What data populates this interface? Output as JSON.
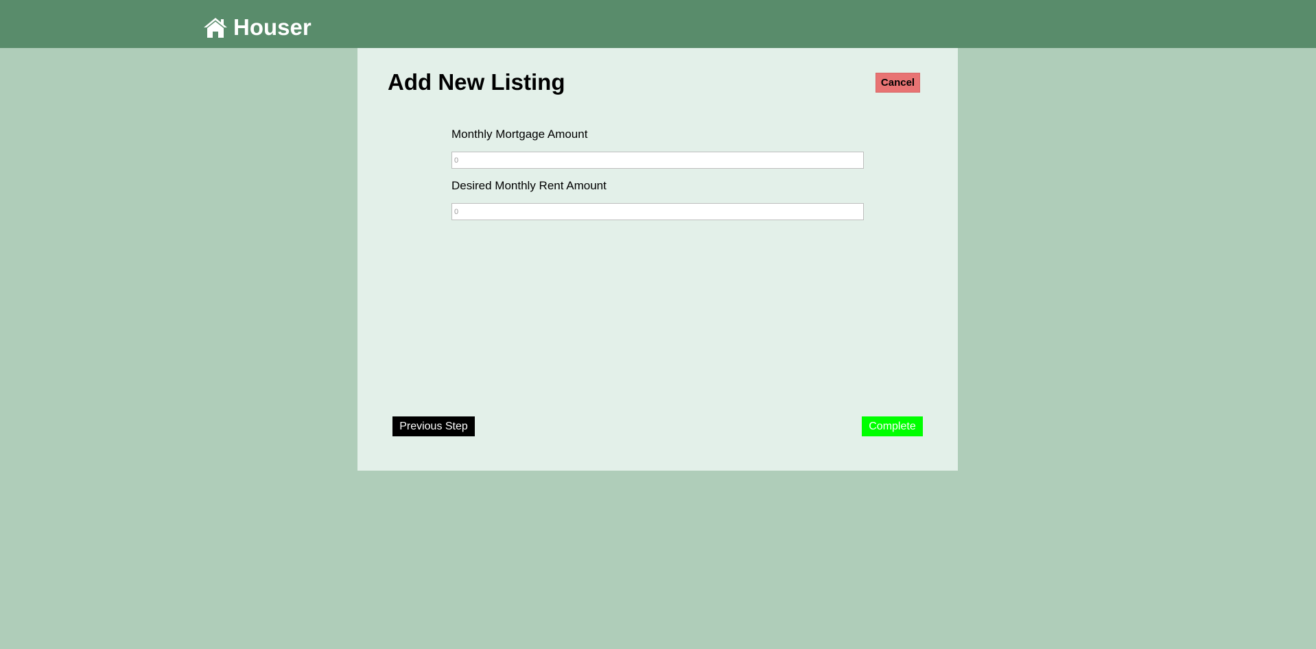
{
  "header": {
    "brand_name": "Houser",
    "logo_icon": "house-icon",
    "background_color": "#598c6b"
  },
  "form": {
    "title": "Add New Listing",
    "cancel_label": "Cancel",
    "fields": [
      {
        "label": "Monthly Mortgage Amount",
        "placeholder": "0",
        "value": ""
      },
      {
        "label": "Desired Monthly Rent Amount",
        "placeholder": "0",
        "value": ""
      }
    ],
    "previous_label": "Previous Step",
    "complete_label": "Complete"
  },
  "colors": {
    "page_background": "#afcdb9",
    "panel_background": "#e3f0e9",
    "cancel_button": "#e87373",
    "complete_button": "#00ff00",
    "previous_button": "#000000"
  }
}
